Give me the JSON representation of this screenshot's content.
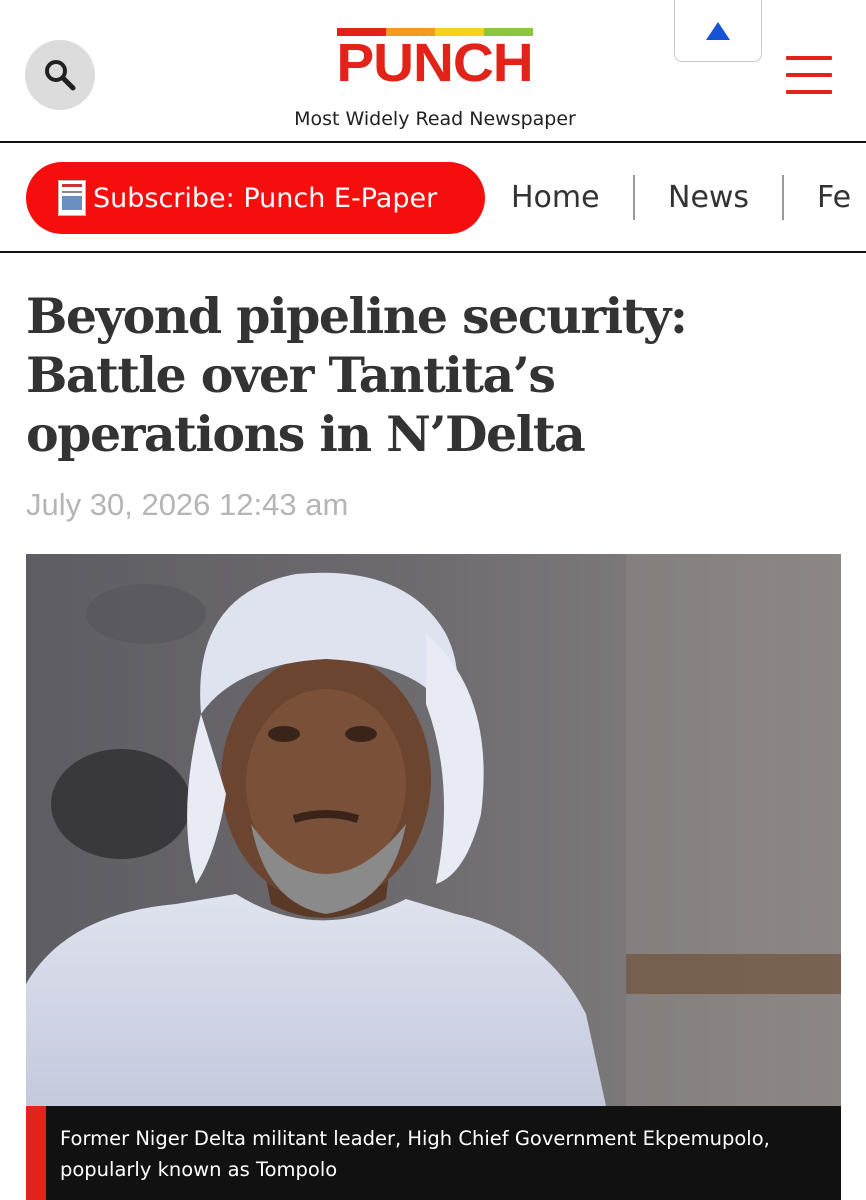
{
  "header": {
    "logo_text": "PUNCH",
    "tagline": "Most Widely Read Newspaper",
    "brand_color": "#e2231a",
    "logo_bar_colors": [
      "#e2231a",
      "#f39b1f",
      "#f6d21a",
      "#8cc63f"
    ],
    "icons": [
      "search-icon",
      "arrow-up-icon",
      "hamburger-menu-icon"
    ]
  },
  "nav": {
    "subscribe_label": "Subscribe: Punch E-Paper",
    "subscribe_color": "#f60d0d",
    "items": [
      "Home",
      "News",
      "Fe"
    ]
  },
  "article": {
    "headline": "Beyond pipeline security: Battle over Tantita’s operations in N’Delta",
    "date": "July 30, 2026 12:43 am",
    "caption": "Former Niger Delta militant leader, High Chief Government Ekpemupolo, popularly known as Tompolo"
  }
}
